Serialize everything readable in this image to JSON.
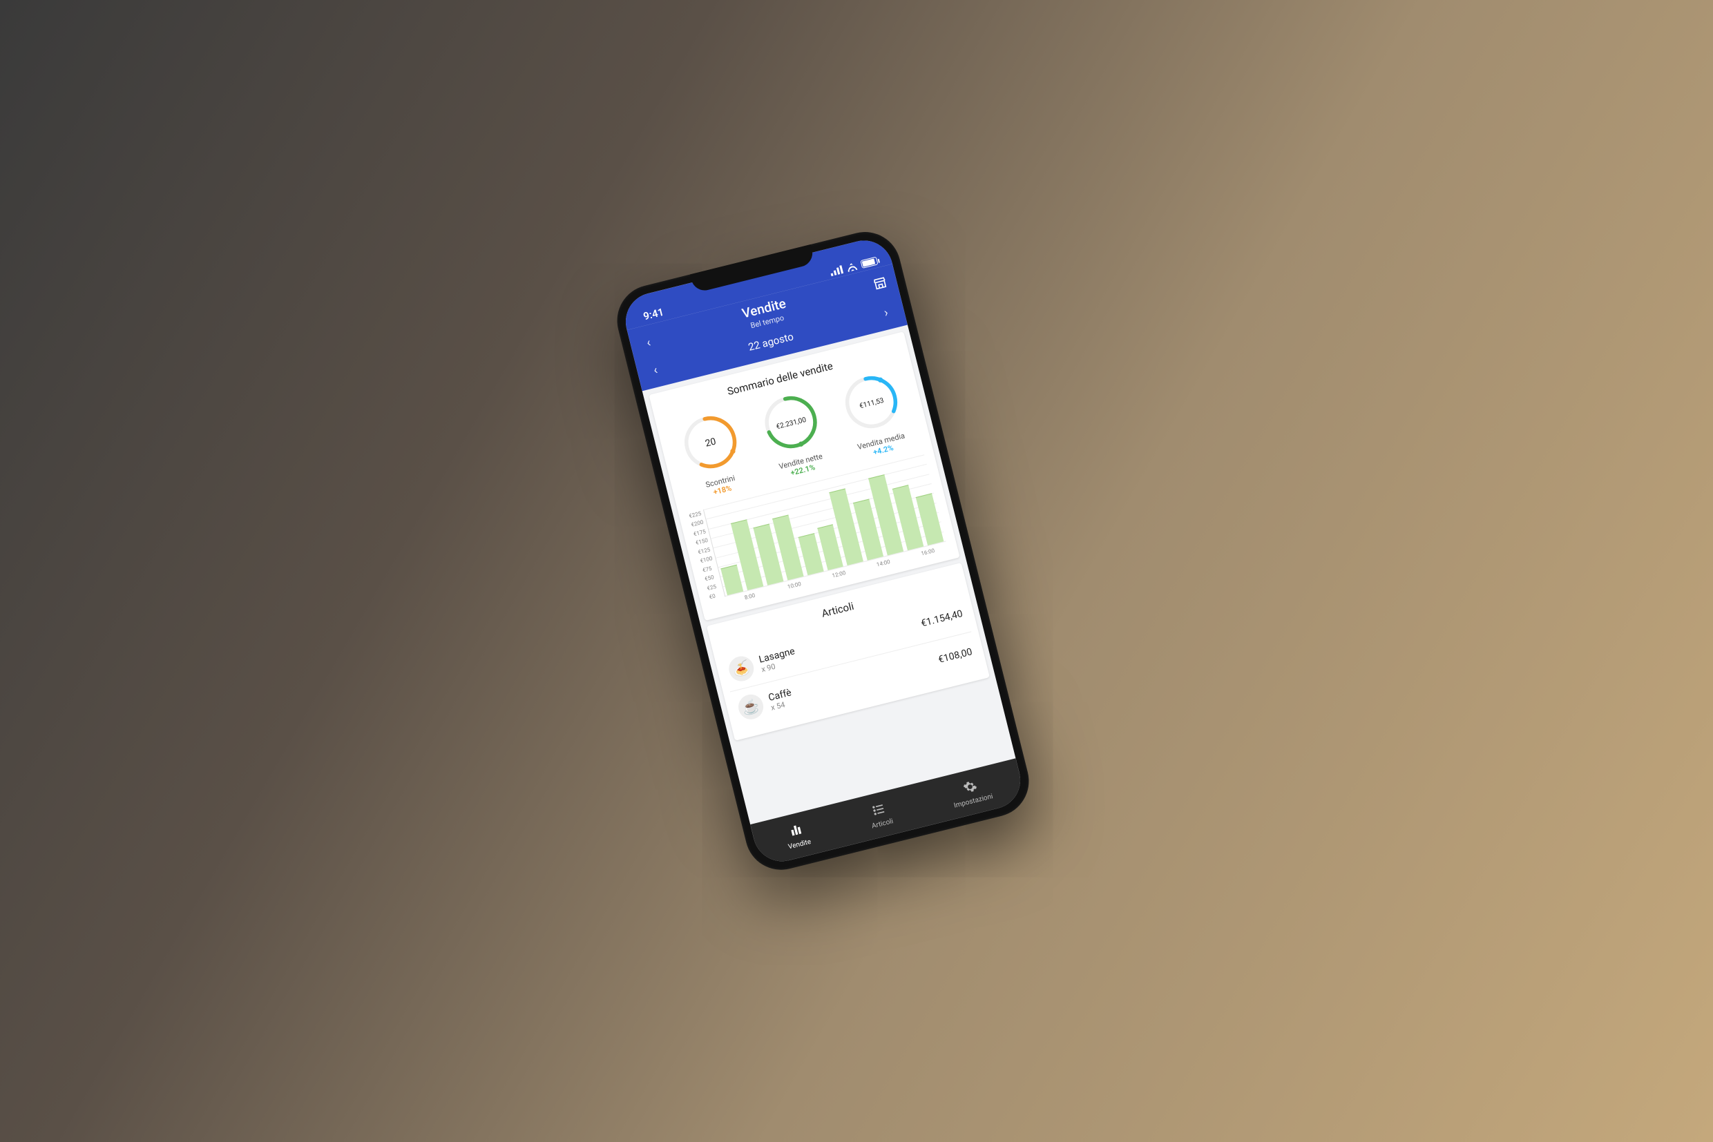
{
  "statusbar": {
    "time": "9:41"
  },
  "header": {
    "title": "Vendite",
    "subtitle": "Bel tempo",
    "date": "22 agosto"
  },
  "summary": {
    "title": "Sommario delle vendite",
    "gauges": [
      {
        "value": "20",
        "label": "Scontrini",
        "delta": "+18%",
        "delta_class": "delta-org",
        "stroke": "#f29a2e",
        "dot": "#f29a2e",
        "pct": 60
      },
      {
        "value": "€2.231,00",
        "label": "Vendite nette",
        "delta": "+22.1%",
        "delta_class": "delta-grn",
        "stroke": "#4caf50",
        "dot": "#4caf50",
        "pct": 72
      },
      {
        "value": "€111,53",
        "label": "Vendita media",
        "delta": "+4.2%",
        "delta_class": "delta-cyn",
        "stroke": "#29b6f6",
        "dot": "#29b6f6",
        "pct": 35
      }
    ]
  },
  "chart_data": {
    "type": "bar",
    "title": "",
    "xlabel": "",
    "ylabel": "",
    "ylim": [
      0,
      225
    ],
    "y_ticks": [
      "€225",
      "€200",
      "€175",
      "€150",
      "€125",
      "€100",
      "€75",
      "€50",
      "€25",
      "€0"
    ],
    "categories": [
      "8:00",
      "10:00",
      "12:00",
      "14:00",
      "16:00"
    ],
    "values": [
      70,
      175,
      150,
      160,
      100,
      110,
      190,
      150,
      200,
      160,
      125
    ]
  },
  "articles": {
    "title": "Articoli",
    "items": [
      {
        "emoji": "🍝",
        "name": "Lasagne",
        "qty": "x 90",
        "price": "€1.154,40"
      },
      {
        "emoji": "☕",
        "name": "Caffè",
        "qty": "x 54",
        "price": "€108,00"
      }
    ]
  },
  "tabs": [
    {
      "label": "Vendite",
      "icon": "bar",
      "active": true
    },
    {
      "label": "Articoli",
      "icon": "list",
      "active": false
    },
    {
      "label": "Impostazioni",
      "icon": "gear",
      "active": false
    }
  ]
}
